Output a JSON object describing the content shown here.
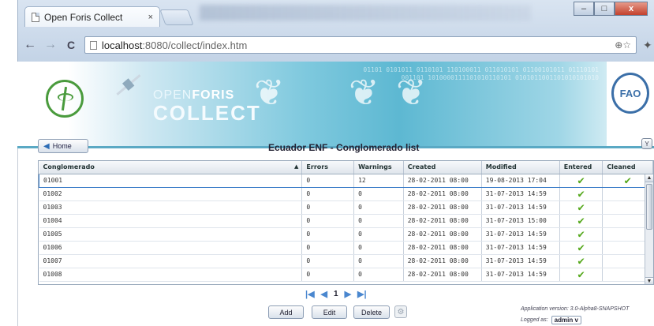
{
  "browser": {
    "tab_title": "Open Foris Collect",
    "tab_close": "×",
    "url_host": "localhost",
    "url_path": ":8080/collect/index.htm",
    "window_buttons": [
      "–",
      "□",
      "x"
    ],
    "nav": {
      "back": "←",
      "forward": "→",
      "reload": "C"
    },
    "address_tools": "⊕☆",
    "wrench": "✦"
  },
  "banner": {
    "brand_top_light": "OPEN",
    "brand_top_bold": "FORIS",
    "brand_bottom": "COLLECT",
    "binary_text": "01101 0101011 0110101 110100011 011010101 01100101011 01110101001101 1010000111101010110101 0101011001101010101010",
    "fao_label": "FAO"
  },
  "toolbar": {
    "home_label": "Home",
    "list_title": "Ecuador ENF - Conglomerado list",
    "filter_icon": "Y"
  },
  "grid": {
    "columns": [
      "Conglomerado",
      "Errors",
      "Warnings",
      "Created",
      "Modified",
      "Entered",
      "Cleaned"
    ],
    "sort_indicator": "▲",
    "check_glyph": "✔",
    "rows": [
      {
        "id": "01001",
        "errors": "0",
        "warnings": "12",
        "created": "28-02-2011 08:00",
        "modified": "19-08-2013 17:04",
        "entered": true,
        "cleaned": true
      },
      {
        "id": "01002",
        "errors": "0",
        "warnings": "0",
        "created": "28-02-2011 08:00",
        "modified": "31-07-2013 14:59",
        "entered": true,
        "cleaned": false
      },
      {
        "id": "01003",
        "errors": "0",
        "warnings": "0",
        "created": "28-02-2011 08:00",
        "modified": "31-07-2013 14:59",
        "entered": true,
        "cleaned": false
      },
      {
        "id": "01004",
        "errors": "0",
        "warnings": "0",
        "created": "28-02-2011 08:00",
        "modified": "31-07-2013 15:00",
        "entered": true,
        "cleaned": false
      },
      {
        "id": "01005",
        "errors": "0",
        "warnings": "0",
        "created": "28-02-2011 08:00",
        "modified": "31-07-2013 14:59",
        "entered": true,
        "cleaned": false
      },
      {
        "id": "01006",
        "errors": "0",
        "warnings": "0",
        "created": "28-02-2011 08:00",
        "modified": "31-07-2013 14:59",
        "entered": true,
        "cleaned": false
      },
      {
        "id": "01007",
        "errors": "0",
        "warnings": "0",
        "created": "28-02-2011 08:00",
        "modified": "31-07-2013 14:59",
        "entered": true,
        "cleaned": false
      },
      {
        "id": "01008",
        "errors": "0",
        "warnings": "0",
        "created": "28-02-2011 08:00",
        "modified": "31-07-2013 14:59",
        "entered": true,
        "cleaned": false
      }
    ],
    "scroll_up": "▲",
    "scroll_down": "▼"
  },
  "pager": {
    "first": "|◀",
    "prev": "◀",
    "page": "1",
    "next": "▶",
    "last": "▶|"
  },
  "actions": {
    "add": "Add",
    "edit": "Edit",
    "delete": "Delete"
  },
  "footer": {
    "version_text": "Application version: 3.0-Alpha8-SNAPSHOT",
    "logged_label": "Logged as:",
    "user": "admin",
    "user_dropdown": "v"
  },
  "colors": {
    "accent": "#3a7cc8",
    "check": "#55a81c",
    "banner": "#5db8d2"
  }
}
